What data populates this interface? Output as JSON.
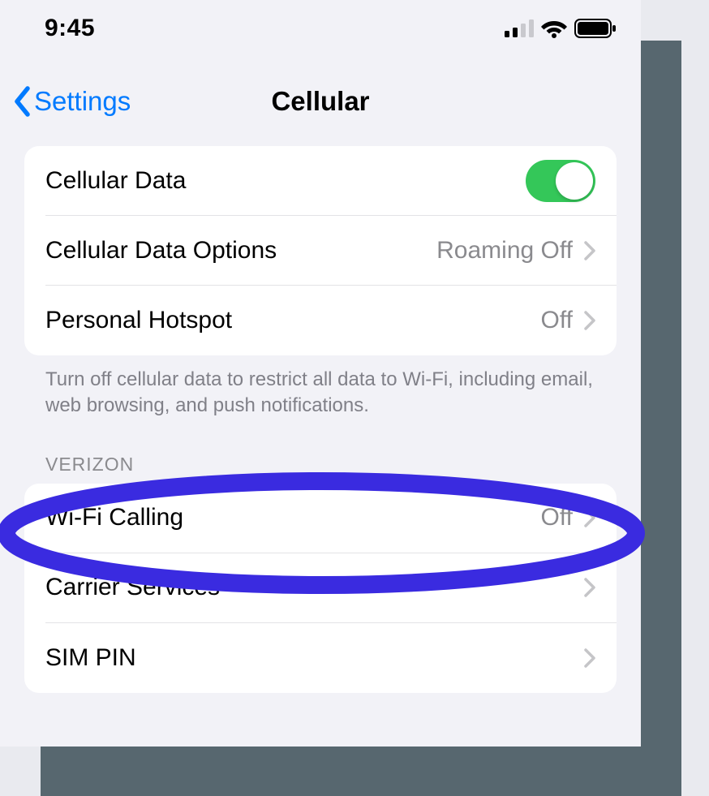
{
  "status": {
    "time": "9:45"
  },
  "nav": {
    "back_label": "Settings",
    "title": "Cellular"
  },
  "group1": {
    "cellular_data_label": "Cellular Data",
    "options_label": "Cellular Data Options",
    "options_value": "Roaming Off",
    "hotspot_label": "Personal Hotspot",
    "hotspot_value": "Off",
    "footer": "Turn off cellular data to restrict all data to Wi-Fi, including email, web browsing, and push notifications."
  },
  "carrier_header": "VERIZON",
  "group2": {
    "wifi_calling_label": "Wi-Fi Calling",
    "wifi_calling_value": "Off",
    "carrier_services_label": "Carrier Services",
    "sim_pin_label": "SIM PIN"
  },
  "colors": {
    "accent": "#007aff",
    "highlight": "#3a2be0"
  }
}
